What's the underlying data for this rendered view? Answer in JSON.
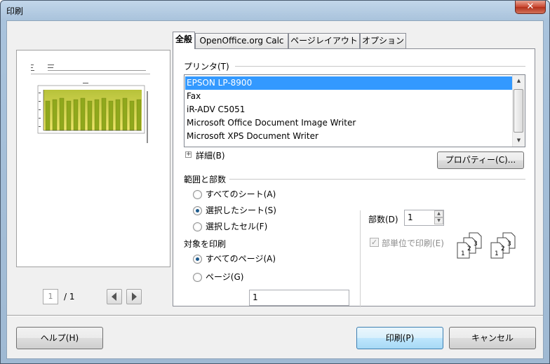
{
  "window": {
    "title": "印刷",
    "close_glyph": "✕"
  },
  "preview": {
    "page_value": "1",
    "page_total": "/ 1",
    "prev_icon": "triangle-left-icon",
    "next_icon": "triangle-right-icon",
    "chart_fill_colors": [
      "#8fa81c",
      "#e8e23c",
      "#6a7a10"
    ]
  },
  "tabs": [
    {
      "label": "全般",
      "active": true
    },
    {
      "label": "OpenOffice.org Calc",
      "active": false
    },
    {
      "label": "ページレイアウト",
      "active": false
    },
    {
      "label": "オプション",
      "active": false
    }
  ],
  "printer_section": {
    "label": "プリンタ(T)",
    "printers": [
      "EPSON LP-8900",
      "Fax",
      "iR-ADV C5051",
      "Microsoft Office Document Image Writer",
      "Microsoft XPS Document Writer"
    ],
    "selected_index": 0,
    "details_label": "詳細(B)",
    "properties_button": "プロパティー(C)..."
  },
  "range_section": {
    "label": "範囲と部数",
    "options": [
      {
        "label": "すべてのシート(A)",
        "checked": false
      },
      {
        "label": "選択したシート(S)",
        "checked": true
      },
      {
        "label": "選択したセル(F)",
        "checked": false
      }
    ],
    "print_target_label": "対象を印刷",
    "target_options": [
      {
        "label": "すべてのページ(A)",
        "checked": true
      },
      {
        "label": "ページ(G)",
        "checked": false
      }
    ],
    "pages_value": "1",
    "copies_label": "部数(D)",
    "copies_value": "1",
    "collate_label": "部単位で印刷(E)",
    "collate_checked": true,
    "collate_pages": [
      "1",
      "2",
      "3"
    ]
  },
  "buttons": {
    "help": "ヘルプ(H)",
    "print": "印刷(P)",
    "cancel": "キャンセル"
  }
}
